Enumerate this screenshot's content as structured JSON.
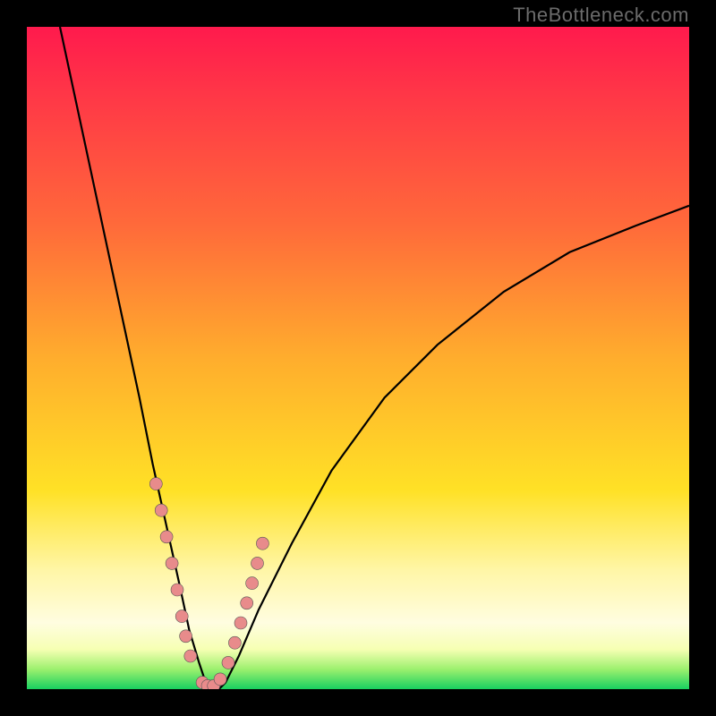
{
  "chart_data": {
    "type": "line",
    "watermark": "TheBottleneck.com",
    "title": "",
    "xlabel": "",
    "ylabel": "",
    "xlim": [
      0,
      100
    ],
    "ylim": [
      0,
      100
    ],
    "curve": {
      "note": "y is bottleneck percentage (100 = top/red, 0 = bottom/green); x is relative hardware balance axis (0–100). Values estimated from pixel positions.",
      "x": [
        5,
        8,
        11,
        14,
        17,
        19,
        21,
        23,
        24.5,
        26,
        27,
        28,
        29,
        30,
        32,
        35,
        40,
        46,
        54,
        62,
        72,
        82,
        92,
        100
      ],
      "y": [
        100,
        86,
        72,
        58,
        44,
        34,
        25,
        16,
        9,
        4,
        1,
        0,
        0,
        1,
        5,
        12,
        22,
        33,
        44,
        52,
        60,
        66,
        70,
        73
      ]
    },
    "dots": {
      "note": "pink marker positions (estimated)",
      "x": [
        19.5,
        20.3,
        21.1,
        21.9,
        22.7,
        23.4,
        24.0,
        24.7,
        26.5,
        27.3,
        28.2,
        29.2,
        30.4,
        31.4,
        32.3,
        33.2,
        34.0,
        34.8,
        35.6
      ],
      "y": [
        31,
        27,
        23,
        19,
        15,
        11,
        8,
        5,
        1,
        0.5,
        0.5,
        1.5,
        4,
        7,
        10,
        13,
        16,
        19,
        22
      ]
    },
    "colors": {
      "curve": "#000000",
      "dot_fill": "#e88b8b",
      "gradient_top": "#ff1a4d",
      "gradient_mid": "#ffe126",
      "gradient_bottom": "#18d060"
    }
  }
}
